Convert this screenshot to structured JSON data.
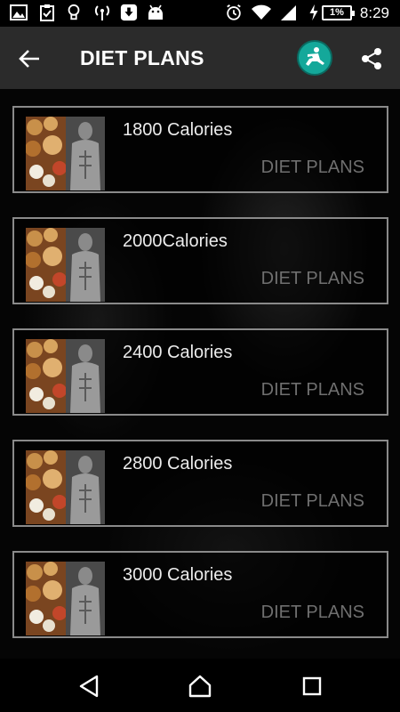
{
  "status_bar": {
    "left_icons": [
      "image-icon",
      "clipboard-check-icon",
      "lightbulb-icon",
      "hotspot-icon",
      "download-icon",
      "android-icon"
    ],
    "right_icons": [
      "alarm-icon",
      "wifi-icon",
      "signal-icon",
      "charging-icon"
    ],
    "battery": "1%",
    "time": "8:29"
  },
  "action_bar": {
    "title": "DIET PLANS",
    "back_icon": "arrow-left-icon",
    "fitness_icon": "fitness-logo-icon",
    "share_icon": "share-icon",
    "accent_color": "#14a89a"
  },
  "plans": [
    {
      "name": "1800 Calories",
      "category": "DIET PLANS"
    },
    {
      "name": "2000Calories",
      "category": "DIET PLANS"
    },
    {
      "name": "2400 Calories",
      "category": "DIET PLANS"
    },
    {
      "name": "2800 Calories",
      "category": "DIET PLANS"
    },
    {
      "name": "3000 Calories",
      "category": "DIET PLANS"
    }
  ],
  "nav_bar": {
    "back": "triangle-back-icon",
    "home": "home-icon",
    "recents": "square-recents-icon"
  }
}
